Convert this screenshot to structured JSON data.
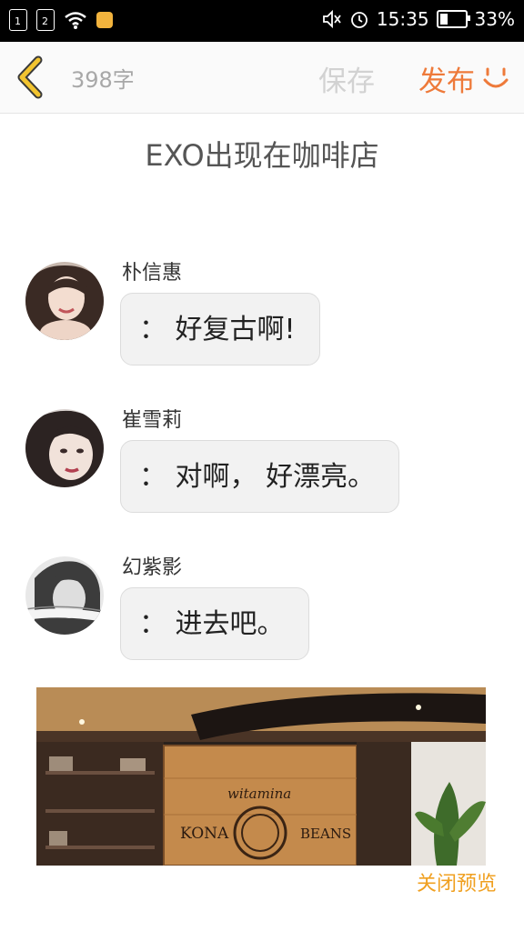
{
  "status_bar": {
    "sim1": "1",
    "sim2": "2",
    "time": "15:35",
    "battery": "33%"
  },
  "toolbar": {
    "word_count": "398字",
    "save": "保存",
    "publish": "发布"
  },
  "article": {
    "title": "EXO出现在咖啡店"
  },
  "messages": [
    {
      "name": "朴信惠",
      "text": "： 好复古啊!"
    },
    {
      "name": "崔雪莉",
      "text": "： 对啊， 好漂亮。"
    },
    {
      "name": "幻紫影",
      "text": "： 进去吧。"
    }
  ],
  "photo": {
    "sign_left": "KONA",
    "sign_right": "BEANS",
    "sign_top": "witamina"
  },
  "footer": {
    "close_preview": "关闭预览"
  },
  "colors": {
    "accent_orange": "#ee7a3a",
    "back_yellow": "#f2c430",
    "preview_link": "#f0a020"
  }
}
